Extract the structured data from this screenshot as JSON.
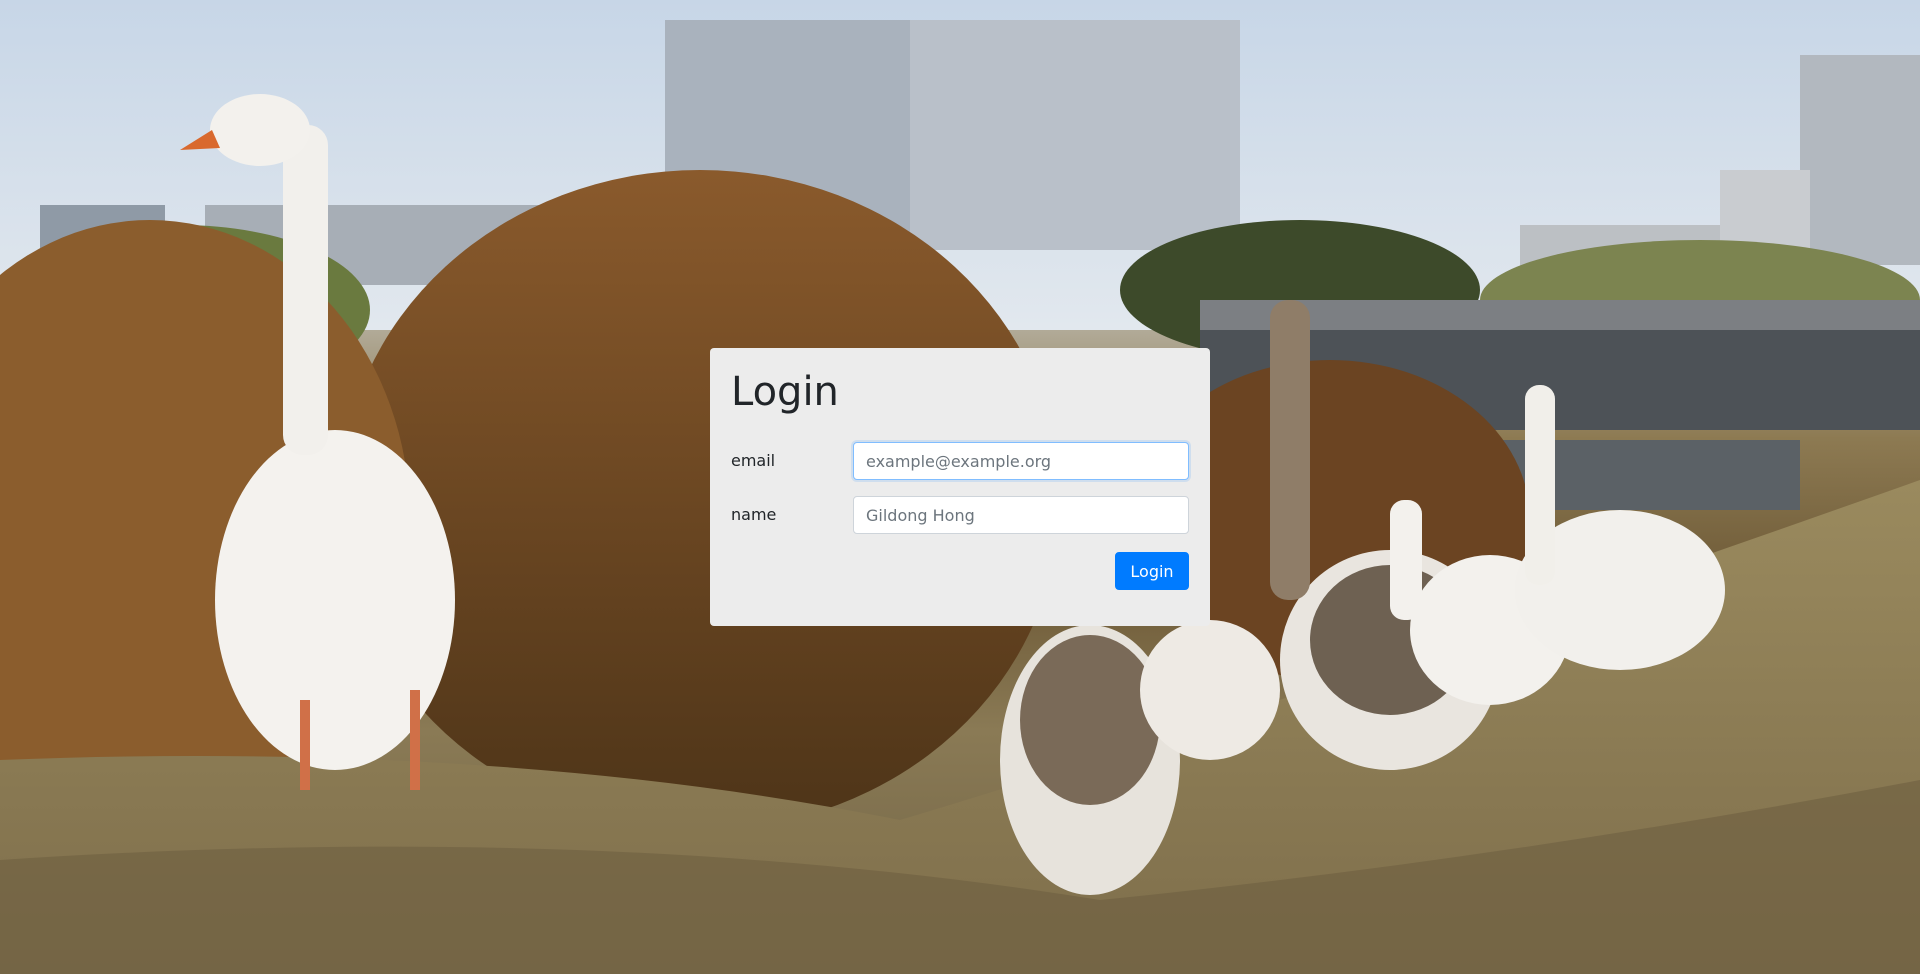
{
  "login": {
    "title": "Login",
    "email_label": "email",
    "email_placeholder": "example@example.org",
    "email_value": "",
    "name_label": "name",
    "name_placeholder": "Gildong Hong",
    "name_value": "",
    "submit_label": "Login"
  },
  "colors": {
    "card_background": "#ececec",
    "primary_button": "#007bff",
    "focus_border": "#80bdff"
  }
}
